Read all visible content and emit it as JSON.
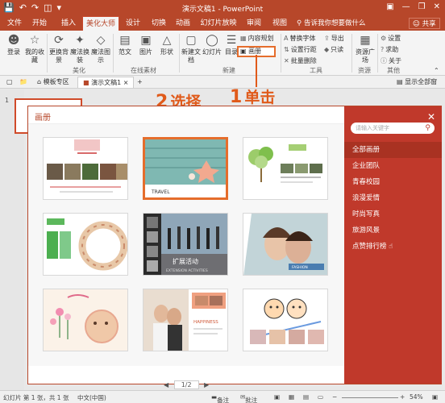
{
  "window": {
    "title": "演示文稿1 - PowerPoint",
    "qat_icons": [
      "save-icon",
      "undo-icon",
      "redo-icon",
      "start-icon"
    ],
    "controls": [
      "ribbon-options-icon",
      "minimize-icon",
      "restore-icon",
      "close-icon"
    ]
  },
  "tabs": {
    "file": "文件",
    "home": "开始",
    "insert": "插入",
    "meihua": "美化大师",
    "design": "设计",
    "transitions": "切换",
    "animations": "动画",
    "slideshow": "幻灯片放映",
    "review": "审阅",
    "view": "视图",
    "tellme": "告诉我你想要做什么",
    "share": "共享"
  },
  "ribbon": {
    "login": "登录",
    "my_collection": "我的收藏",
    "change_bg": "更换背景",
    "magic_change": "魔法换装",
    "magic_diagram": "魔法图示",
    "beautify_group": "美化",
    "text": "范文",
    "image": "图片",
    "shape": "形状",
    "online_group": "在线素材",
    "new_doc": "新建文档",
    "slide": "幻灯片",
    "toc": "目录",
    "content_plan": "内容规划",
    "photo_album": "画册",
    "new_group": "新建",
    "replace_font": "替换字体",
    "set_spacing": "设置行距",
    "batch_delete": "批量删除",
    "export": "导出",
    "only": "只读",
    "tools_group": "工具",
    "resource_plaza": "资源广场",
    "settings": "设置",
    "help": "求助",
    "about": "关于",
    "resources_group": "资源",
    "other_group": "其他"
  },
  "doc_tabs": {
    "template_zone": "模板专区",
    "presentation": "演示文稿1",
    "show_all": "显示全部窗口"
  },
  "slide_pane": {
    "slide_number": "1"
  },
  "annotations": {
    "step1_num": "1",
    "step1_text": "单击",
    "step2_num": "2",
    "step2_text": "选择"
  },
  "dialog": {
    "title": "画册",
    "search_placeholder": "请输入关键字",
    "categories": [
      "全部画册",
      "企业团队",
      "青春校园",
      "浪漫爱情",
      "时尚写真",
      "旅游风景",
      "点赞排行榜"
    ],
    "active_category": "全部画册",
    "pager": "1/2",
    "templates": [
      {
        "name": "family-album"
      },
      {
        "name": "travel-album",
        "label": "TRAVEL"
      },
      {
        "name": "graduation-album"
      },
      {
        "name": "team-album"
      },
      {
        "name": "expansion-activity",
        "label": "扩展活动",
        "sub": "EXTENSION ACTIVITIES"
      },
      {
        "name": "fashion-portrait",
        "label": "FASHION"
      },
      {
        "name": "happy-baby-album"
      },
      {
        "name": "wedding-album",
        "label": "HAPPINESS"
      },
      {
        "name": "cartoon-album"
      }
    ]
  },
  "statusbar": {
    "slide_info": "幻灯片 第 1 张，共 1 张",
    "language": "中文(中国)",
    "notes": "备注",
    "comments": "批注",
    "zoom": "54%"
  }
}
